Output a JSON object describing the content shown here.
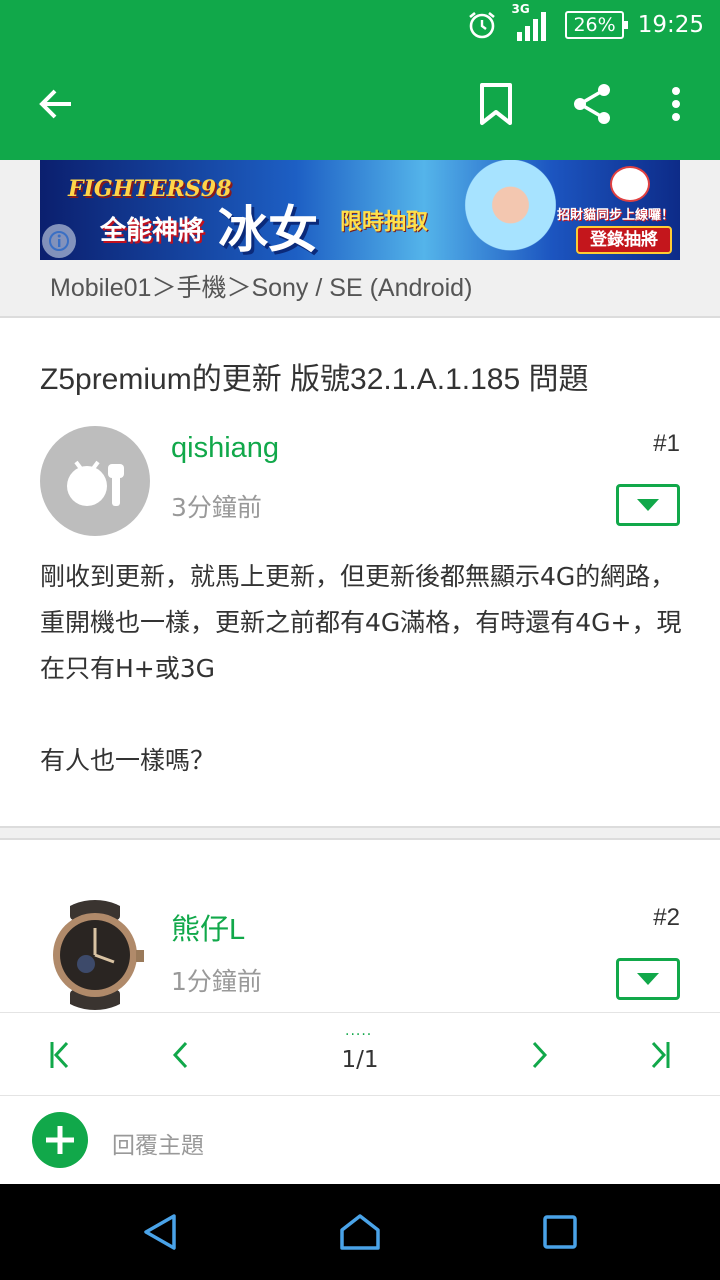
{
  "status_bar": {
    "network": "3G",
    "battery": "26%",
    "time": "19:25"
  },
  "app_bar": {
    "icons": [
      "back-arrow-icon",
      "bookmark-icon",
      "share-icon",
      "more-vert-icon"
    ]
  },
  "banner": {
    "game": "FIGHTERS98",
    "line1": "全能神將",
    "line2": "冰女",
    "line3": "限時抽取",
    "cta_top": "招財貓同步上線囉！",
    "cta": "登錄抽將"
  },
  "breadcrumb": "Mobile01＞手機＞Sony / SE (Android)",
  "thread": {
    "title": "Z5premium的更新 版號32.1.A.1.185 問題"
  },
  "posts": [
    {
      "username": "qishiang",
      "time": "3分鐘前",
      "floor": "#1",
      "content": "剛收到更新，就馬上更新，但更新後都無顯示4G的網路，重開機也一樣，更新之前都有4G滿格，有時還有4G+，現在只有H+或3G\n\n有人也一樣嗎？"
    },
    {
      "username": "熊仔L",
      "time": "1分鐘前",
      "floor": "#2"
    }
  ],
  "pager": {
    "dots": ".....",
    "label": "1/1"
  },
  "reply": {
    "label": "回覆主題"
  },
  "colors": {
    "brand": "#11a84a",
    "background": "#f0f0f0"
  }
}
